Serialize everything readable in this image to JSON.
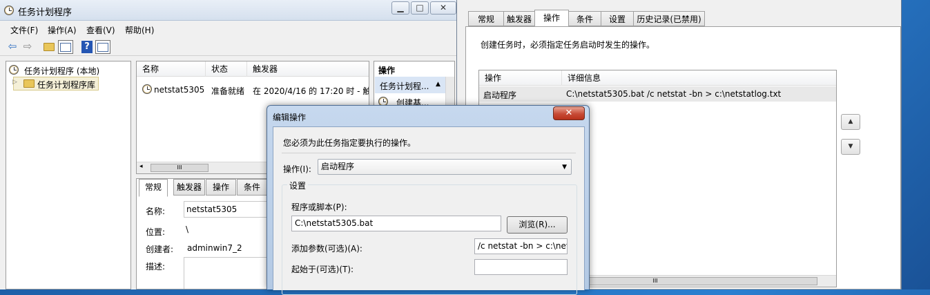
{
  "main": {
    "title": "任务计划程序",
    "controls": {
      "minimize": "▁",
      "restore": "□",
      "close": "✕"
    },
    "menu": [
      "文件(F)",
      "操作(A)",
      "查看(V)",
      "帮助(H)"
    ],
    "tree": {
      "root": "任务计划程序 (本地)",
      "library": "任务计划程序库"
    },
    "list": {
      "columns": [
        "名称",
        "状态",
        "触发器"
      ],
      "row": {
        "name": "netstat5305",
        "status": "准备就绪",
        "trigger": "在 2020/4/16 的 17:20 时 - 触"
      },
      "scroll_grip": "III"
    },
    "actions_pane": {
      "header": "操作",
      "section": "任务计划程...",
      "item": "创建基..."
    },
    "detail": {
      "tabs": [
        "常规",
        "触发器",
        "操作",
        "条件"
      ],
      "name_label": "名称:",
      "name_value": "netstat5305",
      "location_label": "位置:",
      "location_value": "\\",
      "author_label": "创建者:",
      "author_value": "adminwin7_2",
      "desc_label": "描述:"
    }
  },
  "props": {
    "tabs": [
      "常规",
      "触发器",
      "操作",
      "条件",
      "设置",
      "历史记录(已禁用)"
    ],
    "instruction": "创建任务时，必须指定任务启动时发生的操作。",
    "table": {
      "columns": [
        "操作",
        "详细信息"
      ],
      "row": {
        "action": "启动程序",
        "details": "C:\\netstat5305.bat /c netstat -bn > c:\\netstatlog.txt"
      },
      "scroll_grip": "III"
    }
  },
  "dialog": {
    "title": "编辑操作",
    "close": "✕",
    "instruction": "您必须为此任务指定要执行的操作。",
    "action_label": "操作(I):",
    "action_value": "启动程序",
    "settings_label": "设置",
    "program_label": "程序或脚本(P):",
    "program_value": "C:\\netstat5305.bat",
    "browse_label": "浏览(R)...",
    "args_label": "添加参数(可选)(A):",
    "args_value": "/c netstat -bn > c:\\nets",
    "start_label": "起始于(可选)(T):",
    "start_value": ""
  }
}
